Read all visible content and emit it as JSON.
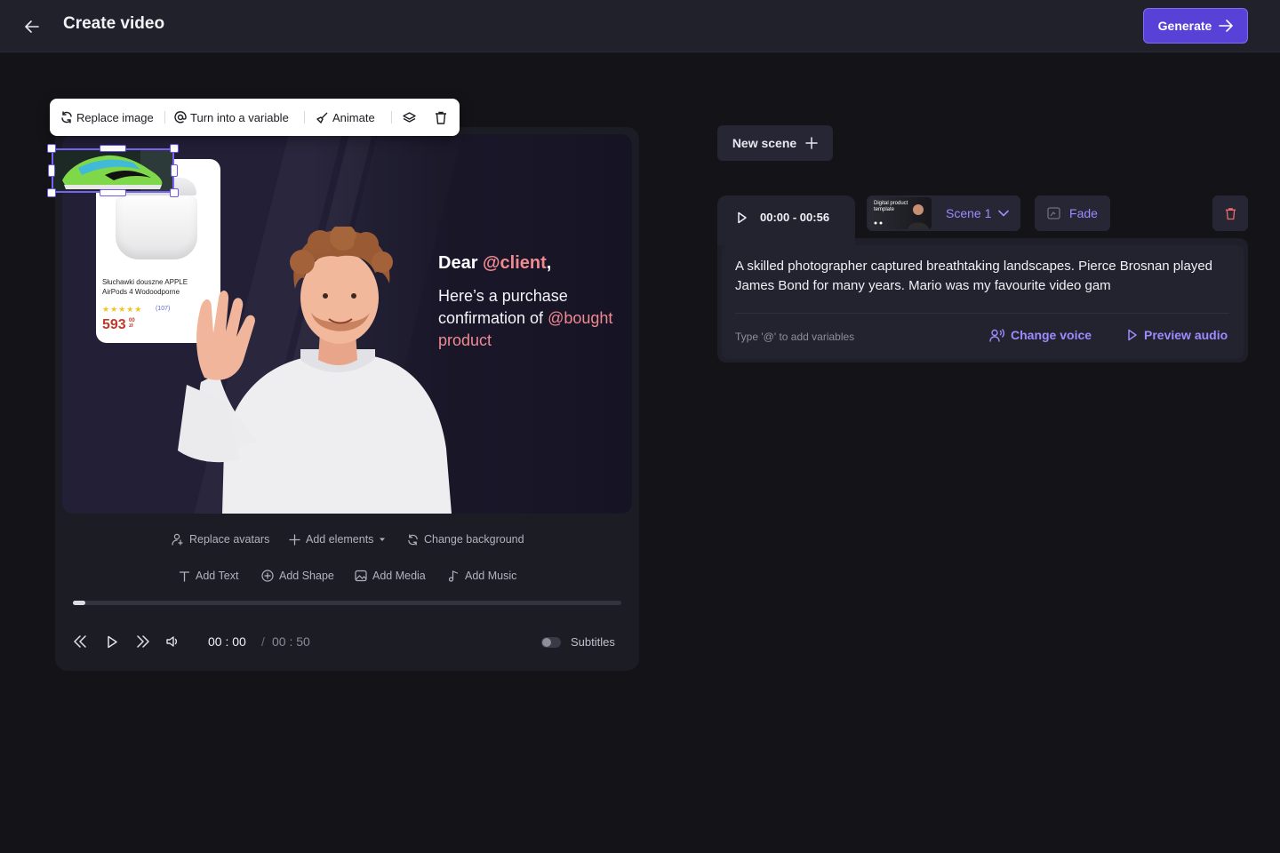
{
  "header": {
    "title": "Create video",
    "generate_label": "Generate"
  },
  "float_toolbar": {
    "replace_image": "Replace image",
    "turn_into_variable": "Turn into a variable",
    "animate": "Animate"
  },
  "canvas": {
    "greeting": "Dear",
    "greeting_variable": "@client",
    "greeting_suffix": ",",
    "body_line": "Here’s a purchase confirmation of",
    "body_variable": "@bought product",
    "product": {
      "name": "Słuchawki douszne APPLE AirPods 4 Wodoodporne",
      "stars": "★★★★★",
      "reviews": "(107)",
      "price_main": "593",
      "price_cents": "00",
      "price_currency": "zł"
    }
  },
  "tools": {
    "replace_avatars": "Replace avatars",
    "add_elements": "Add elements",
    "change_background": "Change background",
    "add_text": "Add Text",
    "add_shape": "Add Shape",
    "add_media": "Add Media",
    "add_music": "Add Music"
  },
  "player": {
    "current_time": "00 : 00",
    "separator": "/",
    "total_time": "00 : 50",
    "progress": 0.02,
    "subtitles_label": "Subtitles",
    "subtitles_on": false
  },
  "scene_panel": {
    "new_scene_label": "New scene",
    "time_range": "00:00 - 00:56",
    "thumbnail_text": "Digital product template",
    "scene_name": "Scene 1",
    "transition_label": "Fade",
    "script": "A skilled photographer captured breathtaking landscapes. Pierce Brosnan played James Bond for many years. Mario was my favourite video gam",
    "variable_hint": "Type '@' to add variables",
    "change_voice_label": "Change voice",
    "preview_audio_label": "Preview audio"
  },
  "colors": {
    "accent": "#5841d6",
    "accent_text": "#9a8cff",
    "variable_pink": "#f08a91",
    "danger": "#f06a6a"
  }
}
